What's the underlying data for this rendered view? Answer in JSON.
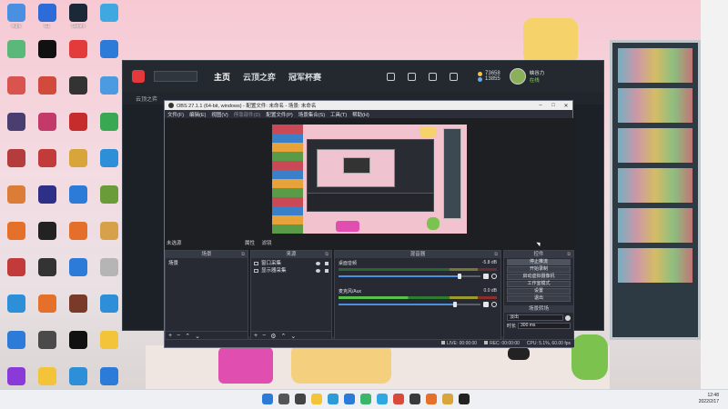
{
  "desktop": {
    "icons": [
      {
        "label": "vupc",
        "color": "#4a90e2"
      },
      {
        "label": "GL",
        "color": "#2d6bd8"
      },
      {
        "label": "Steam",
        "color": "#1b2838"
      },
      {
        "label": "",
        "color": "#40a8e0"
      },
      {
        "label": "",
        "color": "#5ab87a"
      },
      {
        "label": "",
        "color": "#111111"
      },
      {
        "label": "",
        "color": "#e33b3b"
      },
      {
        "label": "",
        "color": "#2d7bd8"
      },
      {
        "label": "",
        "color": "#d9534f"
      },
      {
        "label": "",
        "color": "#d04b3c"
      },
      {
        "label": "",
        "color": "#333333"
      },
      {
        "label": "",
        "color": "#4c9be0"
      },
      {
        "label": "",
        "color": "#4a3d70"
      },
      {
        "label": "",
        "color": "#c33a6a"
      },
      {
        "label": "",
        "color": "#c62c2c"
      },
      {
        "label": "",
        "color": "#39a853"
      },
      {
        "label": "",
        "color": "#b43c3c"
      },
      {
        "label": "",
        "color": "#c33a3a"
      },
      {
        "label": "",
        "color": "#d8a53a"
      },
      {
        "label": "",
        "color": "#2d8fd8"
      },
      {
        "label": "",
        "color": "#db7d36"
      },
      {
        "label": "",
        "color": "#2e2f86"
      },
      {
        "label": "",
        "color": "#2d7bd8"
      },
      {
        "label": "",
        "color": "#6b9c3a"
      },
      {
        "label": "",
        "color": "#e5702a"
      },
      {
        "label": "",
        "color": "#222222"
      },
      {
        "label": "",
        "color": "#e36f2a"
      },
      {
        "label": "",
        "color": "#d7a04b"
      },
      {
        "label": "",
        "color": "#c33a3a"
      },
      {
        "label": "",
        "color": "#333333"
      },
      {
        "label": "",
        "color": "#2d7bd8"
      },
      {
        "label": "",
        "color": "#b5b5b5"
      },
      {
        "label": "",
        "color": "#2d8fd8"
      },
      {
        "label": "",
        "color": "#e5702a"
      },
      {
        "label": "",
        "color": "#7a3a2a"
      },
      {
        "label": "",
        "color": "#2d8fd8"
      },
      {
        "label": "",
        "color": "#2d7bd8"
      },
      {
        "label": "",
        "color": "#4a4a4a"
      },
      {
        "label": "",
        "color": "#111111"
      },
      {
        "label": "",
        "color": "#f3c33a"
      },
      {
        "label": "",
        "color": "#8a3ad8"
      },
      {
        "label": "",
        "color": "#f3c33a"
      },
      {
        "label": "",
        "color": "#2d8fd8"
      },
      {
        "label": "",
        "color": "#2d7bd8"
      }
    ]
  },
  "launcher": {
    "nav": [
      "主页",
      "云顶之弈",
      "冠军杯赛"
    ],
    "stat1": "73658",
    "stat2": "13855",
    "user_name": "峡谷力",
    "user_status": "在线",
    "sub_title": "云顶之弈"
  },
  "obs": {
    "title": "OBS 27.1.1 (64-bit, windows) - 配置文件: 未命名 - 场景: 未命名",
    "menus": [
      "文件(F)",
      "编辑(E)",
      "视图(V)",
      "停靠部件(D)",
      "配置文件(P)",
      "场景集合(S)",
      "工具(T)",
      "帮助(H)"
    ],
    "source_selected_label": "未选源",
    "props_label": "属性",
    "filters_label": "滤镜",
    "docks": {
      "scenes": {
        "title": "场景",
        "items": [
          "场景"
        ]
      },
      "sources": {
        "title": "来源",
        "items": [
          "窗口采集",
          "显示器采集"
        ]
      },
      "mixer": {
        "title": "混音器",
        "channels": [
          {
            "name": "桌面音频",
            "db": "-5.8 dB",
            "level": 0.85
          },
          {
            "name": "麦克风/Aux",
            "db": "0.0 dB",
            "level": 0.82
          }
        ]
      },
      "controls": {
        "title": "控件",
        "buttons": [
          "停止推流",
          "开始录制",
          "启动虚拟摄像机",
          "工作室模式",
          "设置",
          "退出"
        ],
        "transitions_title": "场景转场",
        "transition_value": "淡出",
        "duration_label": "时长",
        "duration_value": "300 ms"
      }
    },
    "status": {
      "live": "LIVE: 00:00:00",
      "rec": "REC: 00:00:00",
      "cpu": "CPU: 5.1%, 60.00 fps"
    }
  },
  "taskbar": {
    "icons": [
      {
        "name": "windows-start-icon",
        "color": "#2d7bd8"
      },
      {
        "name": "search-icon",
        "color": "#555555"
      },
      {
        "name": "task-view-icon",
        "color": "#444444"
      },
      {
        "name": "file-explorer-icon",
        "color": "#f3c33a"
      },
      {
        "name": "edge-icon",
        "color": "#2d9bd8"
      },
      {
        "name": "store-icon",
        "color": "#2d7bd8"
      },
      {
        "name": "chat-icon",
        "color": "#3ab56a"
      },
      {
        "name": "app-icon",
        "color": "#2da8e0"
      },
      {
        "name": "app-icon",
        "color": "#d94a3a"
      },
      {
        "name": "app-icon",
        "color": "#3a3a3a"
      },
      {
        "name": "app-icon",
        "color": "#e5702a"
      },
      {
        "name": "app-icon",
        "color": "#d8a53a"
      },
      {
        "name": "obs-icon",
        "color": "#222222"
      }
    ],
    "time": "12:48",
    "date": "2022/2/17"
  }
}
